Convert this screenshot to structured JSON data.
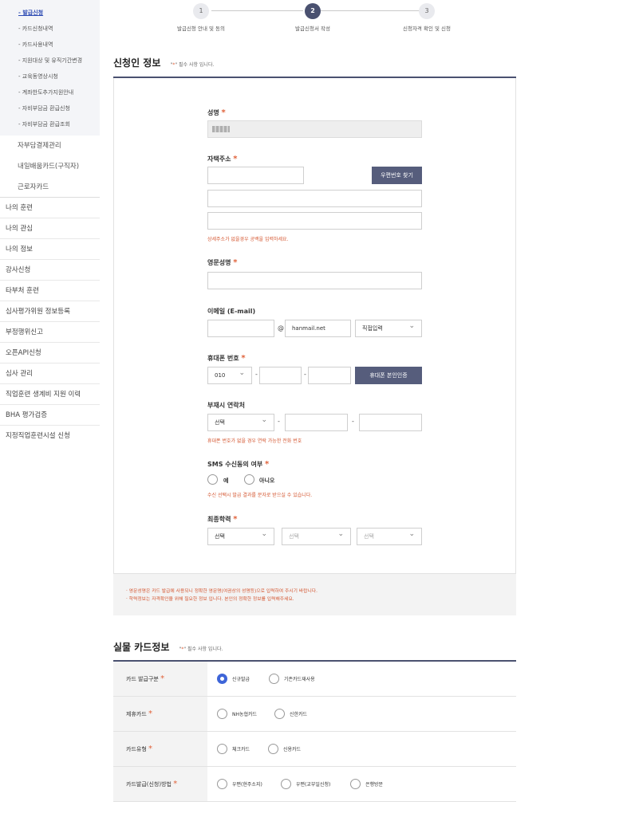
{
  "sidebar": {
    "sub_items": [
      "- 발급신청",
      "- 카드신청내역",
      "- 카드사용내역",
      "- 지원대상 및 유직기간변경",
      "- 교육동영상시청",
      "- 계좌한도추가지원안내",
      "- 자비부담금 환급신청",
      "- 자비부담금 환급조회"
    ],
    "sub2_items": [
      "자부담결제관리",
      "내일배움카드(구직자)",
      "근로자카드"
    ],
    "main_items": [
      "나의 훈련",
      "나의 관심",
      "나의 정보",
      "강사신청",
      "타부처 훈련",
      "심사평가위원 정보등록",
      "부정행위신고",
      "오픈API신청",
      "심사 관리",
      "직업훈련 생계비 지원 이력",
      "BHA 평가검증",
      "지정직업훈련시설 신청"
    ]
  },
  "steps": [
    {
      "num": "1",
      "label": "발급신청 안내 및 동의"
    },
    {
      "num": "2",
      "label": "발급신청서 작성"
    },
    {
      "num": "3",
      "label": "신청자격 확인 및 신청"
    }
  ],
  "applicant": {
    "title": "신청인 정보",
    "note_pre": "\"",
    "note_star": "*",
    "note_post": "\" 필수 사항 입니다.",
    "name_label": "성명",
    "address_label": "자택주소",
    "zip_button": "우편번호 찾기",
    "address_hint": "상세주소가 없을경우 공백을 입력하세요.",
    "eng_name_label": "영문성명",
    "email_label": "이메일 (E-mail)",
    "email_at": "@",
    "email_domain": "hanmail.net",
    "email_select": "직접입력",
    "phone_label": "휴대폰 번호",
    "phone_prefix": "010",
    "phone_dash": "-",
    "phone_button": "휴대폰 본인인증",
    "alt_label": "부재시 연락처",
    "alt_select": "선택",
    "alt_hint": "휴대폰 번호가 없을 경우 연락 가능한 전화 번호",
    "sms_label": "SMS 수신동의 여부",
    "sms_yes": "예",
    "sms_no": "아니오",
    "sms_hint": "수신 선택시 발급 결과를 문자로 받으실 수 있습니다.",
    "edu_label": "최종학력",
    "edu_select1": "선택",
    "edu_select2": "선택",
    "edu_select3": "선택",
    "req_star": "*"
  },
  "notice": [
    "· 영문성명은 카드 발급에 사용되니 정확한 영문명(여권상의 성명등)으로 입력하여 주시기 바랍니다.",
    "· 학력정보는 자격확인을 위해 필요한 정보 입니다. 본인의 정확한 정보를 입력해주세요."
  ],
  "card": {
    "title": "실물 카드정보",
    "note_post": "\" 필수 사항 입니다.",
    "rows": [
      {
        "label": "카드 발급구분",
        "options": [
          "신규발급",
          "기존카드재사용"
        ],
        "selected": 0
      },
      {
        "label": "제휴카드",
        "options": [
          "NH농협카드",
          "신한카드"
        ],
        "selected": -1
      },
      {
        "label": "카드유형",
        "options": [
          "체크카드",
          "신용카드"
        ],
        "selected": -1
      },
      {
        "label": "카드발급(신청)방법",
        "options": [
          "우편(현주소지)",
          "우편(교부일신청)",
          "은행방문"
        ],
        "selected": -1
      }
    ]
  },
  "colors": {
    "accent": "#4a5170",
    "required": "#e0623a",
    "radio_on": "#3e65d8"
  }
}
